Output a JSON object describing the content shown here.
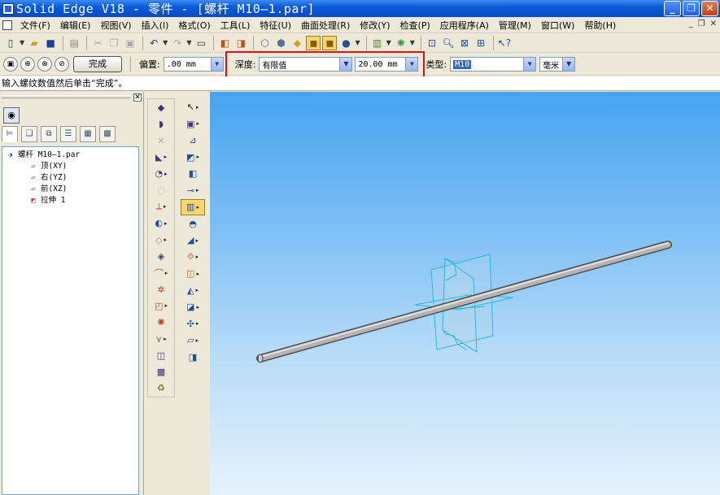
{
  "window": {
    "title": "Solid Edge V18 - 零件 - [螺杆 M10—1.par]",
    "buttons": [
      "_",
      "❐",
      "✕"
    ]
  },
  "menu": {
    "items": [
      "文件(F)",
      "编辑(E)",
      "视图(V)",
      "插入(I)",
      "格式(O)",
      "工具(L)",
      "特征(U)",
      "曲面处理(R)",
      "修改(Y)",
      "检查(P)",
      "应用程序(A)",
      "管理(M)",
      "窗口(W)",
      "帮助(H)"
    ],
    "mdi_buttons": [
      "_",
      "❐",
      "✕"
    ]
  },
  "ribbon": {
    "finish_label": "完成",
    "offset_label": "偏置:",
    "offset_value": ".00 mm",
    "depth_label": "深度:",
    "depth_value": "有限值",
    "depth_amount": "20.00 mm",
    "type_label": "类型:",
    "type_value": "M10",
    "unit_value": "毫米"
  },
  "prompt": {
    "text": "输入螺纹数值然后单击“完成”。"
  },
  "tree": {
    "root": "螺杆 M10—1.par",
    "children": [
      "顶(XY)",
      "右(YZ)",
      "前(XZ)",
      "拉伸 1"
    ]
  },
  "colors": {
    "titlebar": "#0a5bd8",
    "highlight": "#e01010",
    "viewport_top": "#46a4f0",
    "viewport_bottom": "#e6f2fb",
    "rod": "#9a9a9a",
    "planes": "#2ab6e6"
  }
}
